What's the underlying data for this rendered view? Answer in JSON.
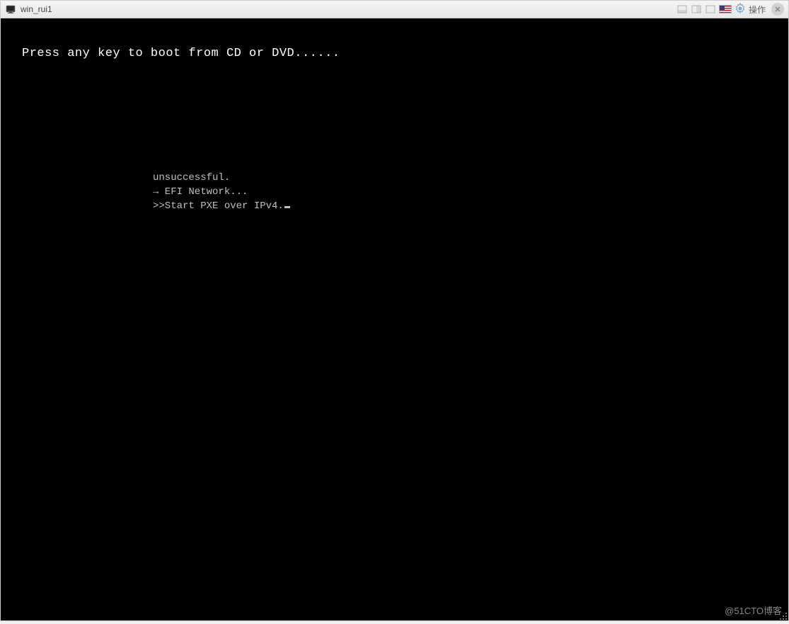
{
  "titlebar": {
    "title": "win_rui1",
    "action_label": "操作"
  },
  "console": {
    "boot_prompt": "Press any key to boot from CD or DVD......",
    "status_line1": "unsuccessful.",
    "status_line2": "→ EFI Network...",
    "status_line3": ">>Start PXE over IPv4."
  },
  "watermark": "@51CTO博客"
}
